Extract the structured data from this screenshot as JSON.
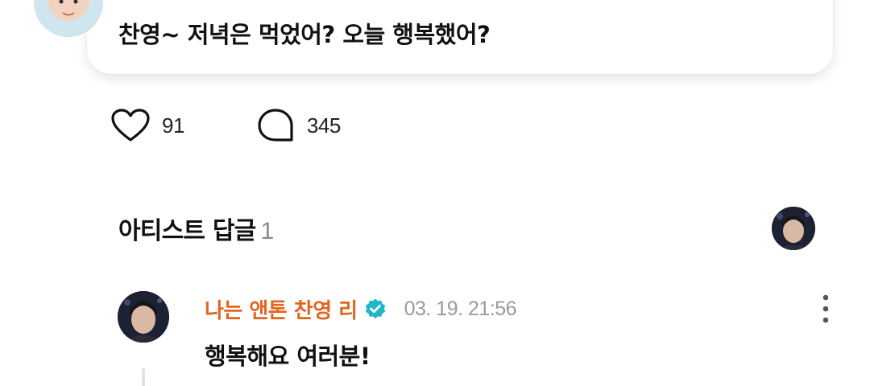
{
  "post": {
    "text": "찬영~ 저녁은 먹었어? 오늘 행복했어?",
    "avatar_icon": "user-avatar-photo"
  },
  "reactions": {
    "likes": {
      "icon": "heart-icon",
      "count": "91"
    },
    "comments": {
      "icon": "comment-bubble-icon",
      "count": "345"
    }
  },
  "artist_replies": {
    "title": "아티스트 답글",
    "count": "1",
    "header_avatar_icon": "artist-avatar-photo"
  },
  "reply": {
    "author": "나는 앤톤 찬영 리",
    "verified_icon": "verified-badge-icon",
    "timestamp": "03. 19. 21:56",
    "text": "행복해요 여러분!",
    "more_icon": "more-vertical-icon"
  },
  "colors": {
    "author_accent": "#e0651f",
    "verified_badge": "#1fb6c8",
    "muted_text": "#9a9a9a"
  }
}
